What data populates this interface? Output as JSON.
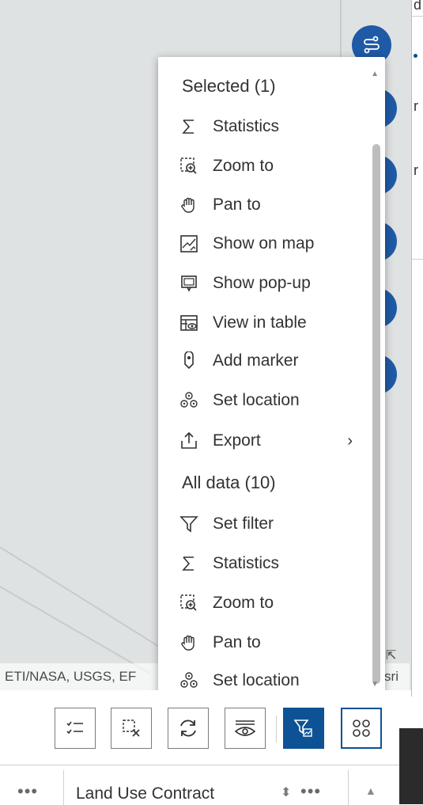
{
  "map": {
    "attribution_text": "ETI/NASA, USGS, EF",
    "attribution_right": "sri"
  },
  "menu": {
    "selected_title": "Selected (1)",
    "selected_items": [
      {
        "label": "Statistics",
        "icon": "sigma-icon"
      },
      {
        "label": "Zoom to",
        "icon": "zoom-to-icon"
      },
      {
        "label": "Pan to",
        "icon": "hand-icon"
      },
      {
        "label": "Show on map",
        "icon": "show-on-map-icon"
      },
      {
        "label": "Show pop-up",
        "icon": "popup-icon"
      },
      {
        "label": "View in table",
        "icon": "table-view-icon"
      },
      {
        "label": "Add marker",
        "icon": "marker-icon"
      },
      {
        "label": "Set location",
        "icon": "set-location-icon"
      },
      {
        "label": "Export",
        "icon": "export-icon",
        "submenu": "›"
      }
    ],
    "all_title": "All data (10)",
    "all_items": [
      {
        "label": "Set filter",
        "icon": "filter-icon"
      },
      {
        "label": "Statistics",
        "icon": "sigma-icon"
      },
      {
        "label": "Zoom to",
        "icon": "zoom-to-icon"
      },
      {
        "label": "Pan to",
        "icon": "hand-icon"
      },
      {
        "label": "Set location",
        "icon": "set-location-icon"
      }
    ]
  },
  "toolbar": {
    "buttons": [
      {
        "icon": "list-check-icon"
      },
      {
        "icon": "clear-selection-icon"
      },
      {
        "icon": "refresh-icon"
      },
      {
        "icon": "show-eye-icon"
      },
      {
        "icon": "filter-map-icon",
        "active": true
      },
      {
        "icon": "grid-icon"
      }
    ]
  },
  "table": {
    "column_label": "Land Use Contract",
    "more_left": "•••",
    "more_right": "•••",
    "sort_glyph": "⬍",
    "scroll_glyph": "▲"
  },
  "side_panel": {
    "chars": [
      "d",
      "r",
      "r"
    ]
  },
  "colors": {
    "accent": "#0d5294",
    "map_button": "#1f5aa6",
    "map_bg": "#dfe2e2"
  }
}
